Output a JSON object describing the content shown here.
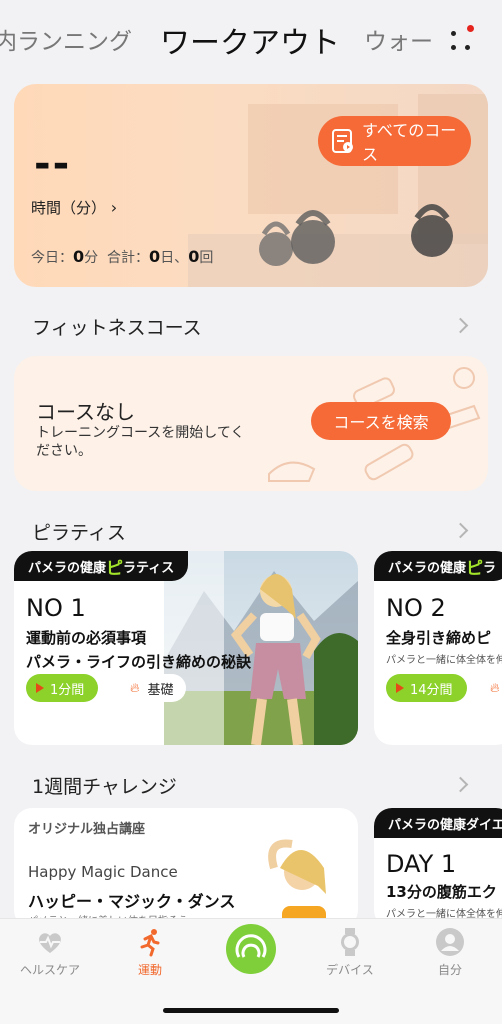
{
  "header": {
    "tab_left": "内ランニング",
    "tab_center": "ワークアウト",
    "tab_right": "ウォー"
  },
  "summary": {
    "value": "--",
    "all_courses": "すべてのコース",
    "time_label": "時間（分）",
    "today_label": "今日：",
    "today_value": "0",
    "today_unit": "分",
    "total_label": "合計：",
    "total_days": "0",
    "total_days_unit": "日、",
    "total_count": "0",
    "total_count_unit": "回"
  },
  "fitness": {
    "title": "フィットネスコース",
    "card_title": "コースなし",
    "card_sub": "トレーニングコースを開始してください。",
    "search_button": "コースを検索"
  },
  "pilates": {
    "title": "ピラティス",
    "cards": [
      {
        "tag_prefix": "パメラの健康",
        "tag_hl": "ピ",
        "tag_rest": "ラティス",
        "number": "NO 1",
        "line1": "運動前の必須事項",
        "line2": "パメラ・ライフの引き締めの秘訣",
        "duration": "1分間",
        "level": "基礎"
      },
      {
        "tag_prefix": "パメラの健康",
        "tag_hl": "ピ",
        "tag_rest": "ラ",
        "number": "NO 2",
        "line1": "全身引き締めピ",
        "sub": "パメラと一緒に体全体を伸ばし",
        "duration": "14分間"
      }
    ]
  },
  "challenge": {
    "title": "1週間チャレンジ",
    "cards": [
      {
        "tag": "オリジナル独占講座",
        "en_title": "Happy Magic Dance",
        "jp_title": "ハッピー・マジック・ダンス",
        "sub": "パメラと一緒に美しい体を目指そう"
      },
      {
        "tag": "パメラの健康ダイエ",
        "day": "DAY 1",
        "line1": "13分の腹筋エク",
        "sub": "パメラと一緒に体全体を伸ばし"
      }
    ]
  },
  "nav": {
    "items": [
      {
        "label": "ヘルスケア",
        "icon": "heart-pulse-icon"
      },
      {
        "label": "運動",
        "icon": "running-icon"
      },
      {
        "label": "",
        "icon": "workout-start-icon"
      },
      {
        "label": "デバイス",
        "icon": "watch-icon"
      },
      {
        "label": "自分",
        "icon": "profile-icon"
      }
    ]
  },
  "colors": {
    "accent": "#f56a36",
    "green": "#8cd22a",
    "lime": "#a2e52a"
  }
}
